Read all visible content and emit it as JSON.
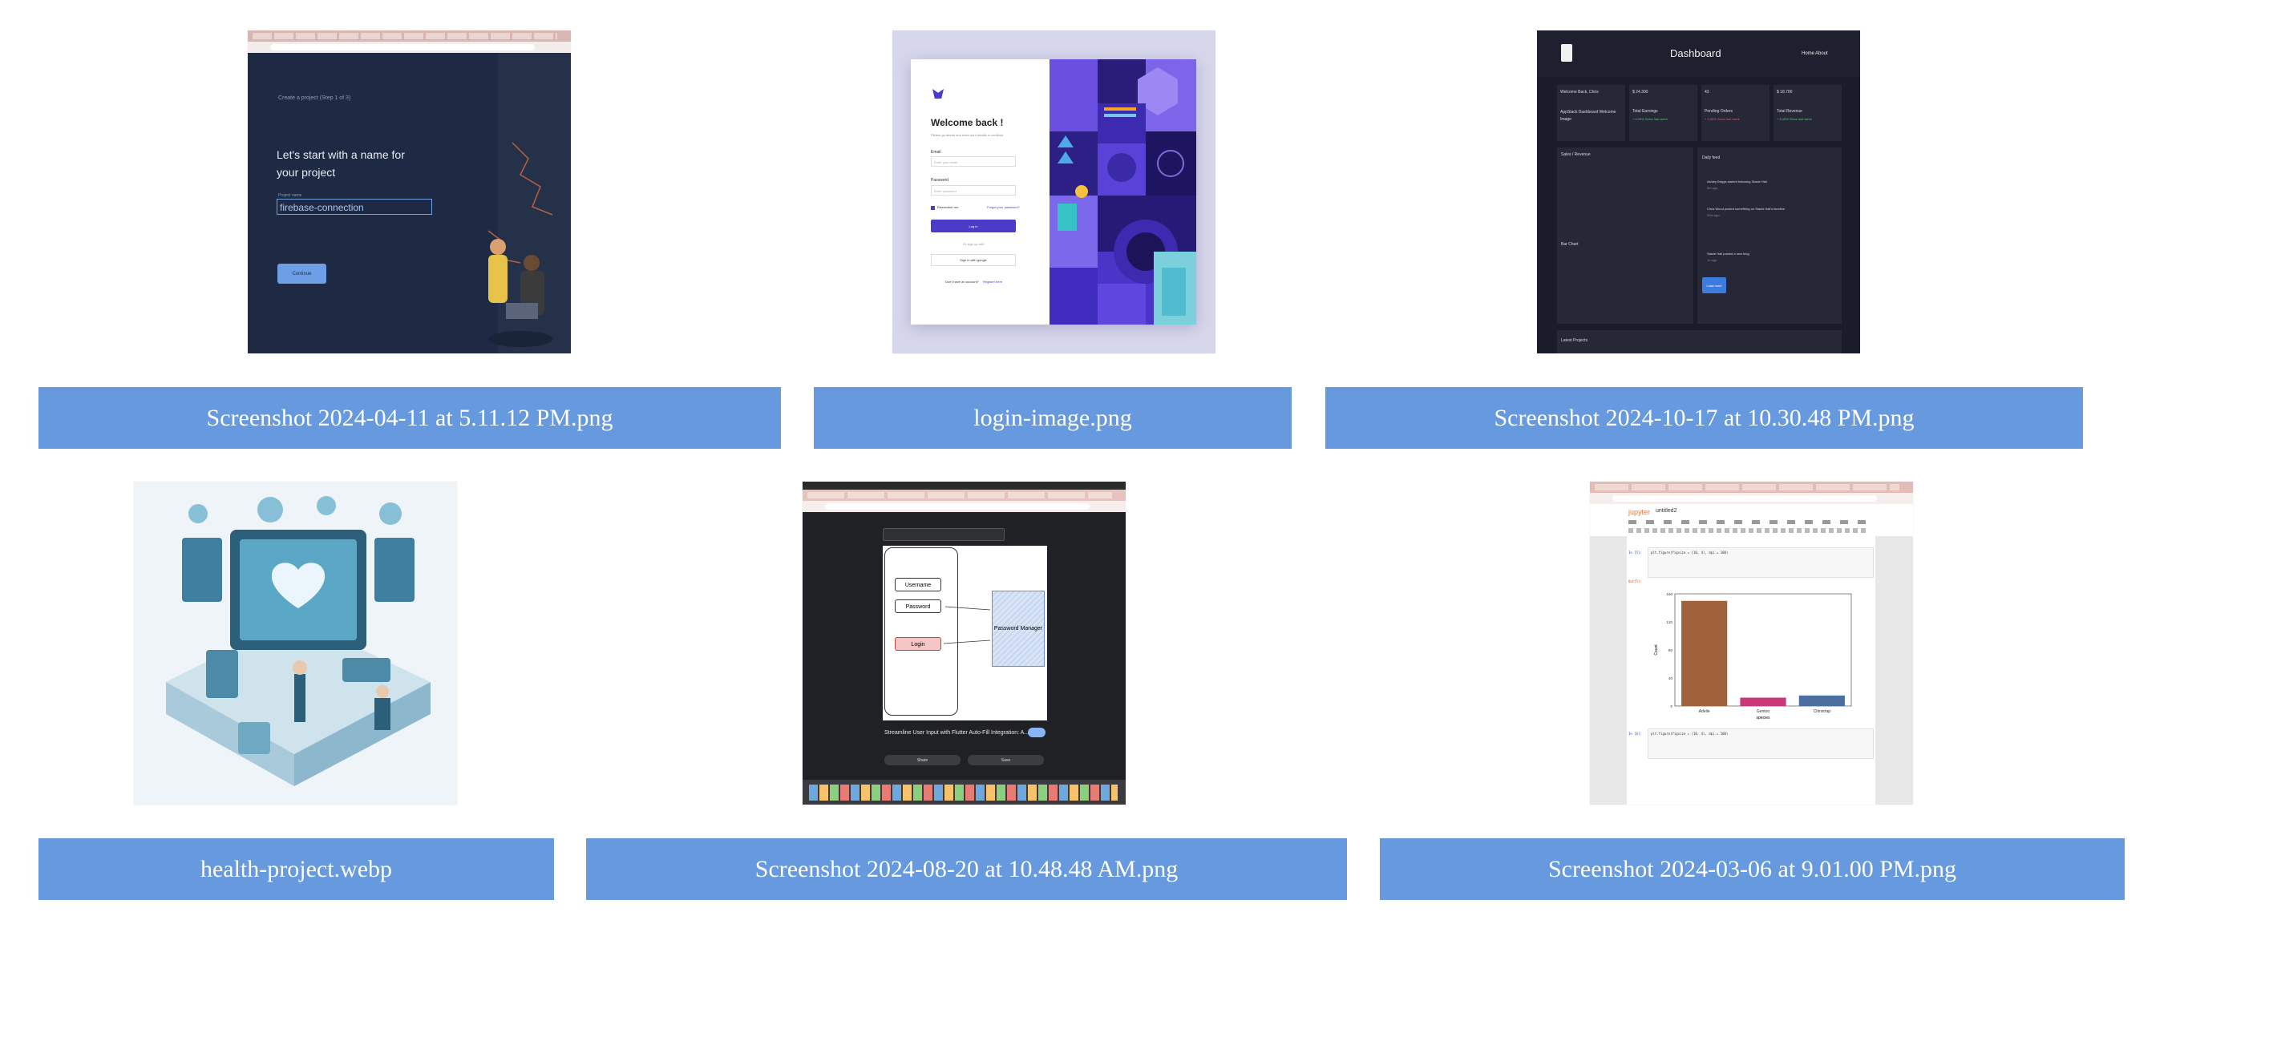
{
  "files": [
    {
      "name": "Screenshot 2024-04-11 at 5.11.12 PM.png"
    },
    {
      "name": "login-image.png"
    },
    {
      "name": "Screenshot 2024-10-17 at 10.30.48 PM.png"
    },
    {
      "name": "health-project.webp"
    },
    {
      "name": "Screenshot 2024-08-20 at 10.48.48 AM.png"
    },
    {
      "name": "Screenshot 2024-03-06 at 9.01.00 PM.png"
    }
  ],
  "thumb1": {
    "step": "Create a project (Step 1 of 3)",
    "heading_line1": "Let's start with a name for",
    "heading_line2": "your project",
    "field_label": "Project name",
    "field_value": "firebase-connection",
    "continue_label": "Continue"
  },
  "thumb2": {
    "title": "Welcome back !",
    "subtitle": "Please go ahead and enter your details to continue",
    "email_label": "Email",
    "email_placeholder": "Enter your email",
    "password_label": "Password",
    "password_placeholder": "Enter password",
    "remember": "Remember me",
    "forgot": "Forgot your password?",
    "login_button": "Log in",
    "or": "Or sign up with",
    "google": "Sign in with google",
    "no_account": "Don't have an account?",
    "register": "Register here"
  },
  "thumb3": {
    "title": "Dashboard",
    "nav_home": "Home",
    "nav_about": "About",
    "cards": [
      {
        "value": "Welcome Back, Chris",
        "sub": "AppStack Dashboard Welcome Image"
      },
      {
        "value": "$ 24.300",
        "label": "Total Earnings",
        "delta": "+ 6.25% Since last week"
      },
      {
        "value": "43",
        "label": "Pending Orders",
        "delta": "+ 4.65% Since last week"
      },
      {
        "value": "$ 18.700",
        "label": "Total Revenue",
        "delta": "+ 8.35% Since last week"
      }
    ],
    "sales_title": "Sales / Revenue",
    "bar_chart": "Bar Chart",
    "daily_feed": "Daily feed",
    "feed": [
      {
        "text": "Ashley Briggs started following Stacie Hall",
        "time": "5m ago"
      },
      {
        "text": "Chris Wood posted something on Stacie Hall's timeline",
        "time": "30m ago"
      },
      {
        "text": "Stacie Hall posted a new blog",
        "time": "1h ago"
      }
    ],
    "load_more": "Load more",
    "latest_projects": "Latest Projects"
  },
  "thumb5": {
    "title": "Streamline User Input with Flutter Auto-Fill Integration: A...",
    "username": "Username",
    "password": "Password",
    "login": "Login",
    "password_manager": "Password Manager",
    "share": "Share",
    "save": "Save"
  },
  "thumb6": {
    "app": "jupyter",
    "notebook": "untitled2",
    "in_label_1": "In [5]:",
    "code_1": "plt.figure(figsize = (10, 4), dpi = 100)",
    "out_label_1": "Out[5]:",
    "in_label_2": "In [6]:",
    "code_2": "plt.figure(figsize = (10, 4), dpi = 100)",
    "ylabel": "Count",
    "xlabel": "species"
  },
  "chart_data": {
    "type": "bar",
    "categories": [
      "Adelie",
      "Gentoo",
      "Chinstrap"
    ],
    "values": [
      150,
      12,
      15
    ],
    "ylim": [
      0,
      160
    ],
    "ylabel": "Count",
    "xlabel": "species",
    "colors": [
      "#a0623a",
      "#c8397a",
      "#4a6fa0"
    ]
  },
  "colors": {
    "label_bg": "#6699dd",
    "label_text": "#ffffff"
  }
}
